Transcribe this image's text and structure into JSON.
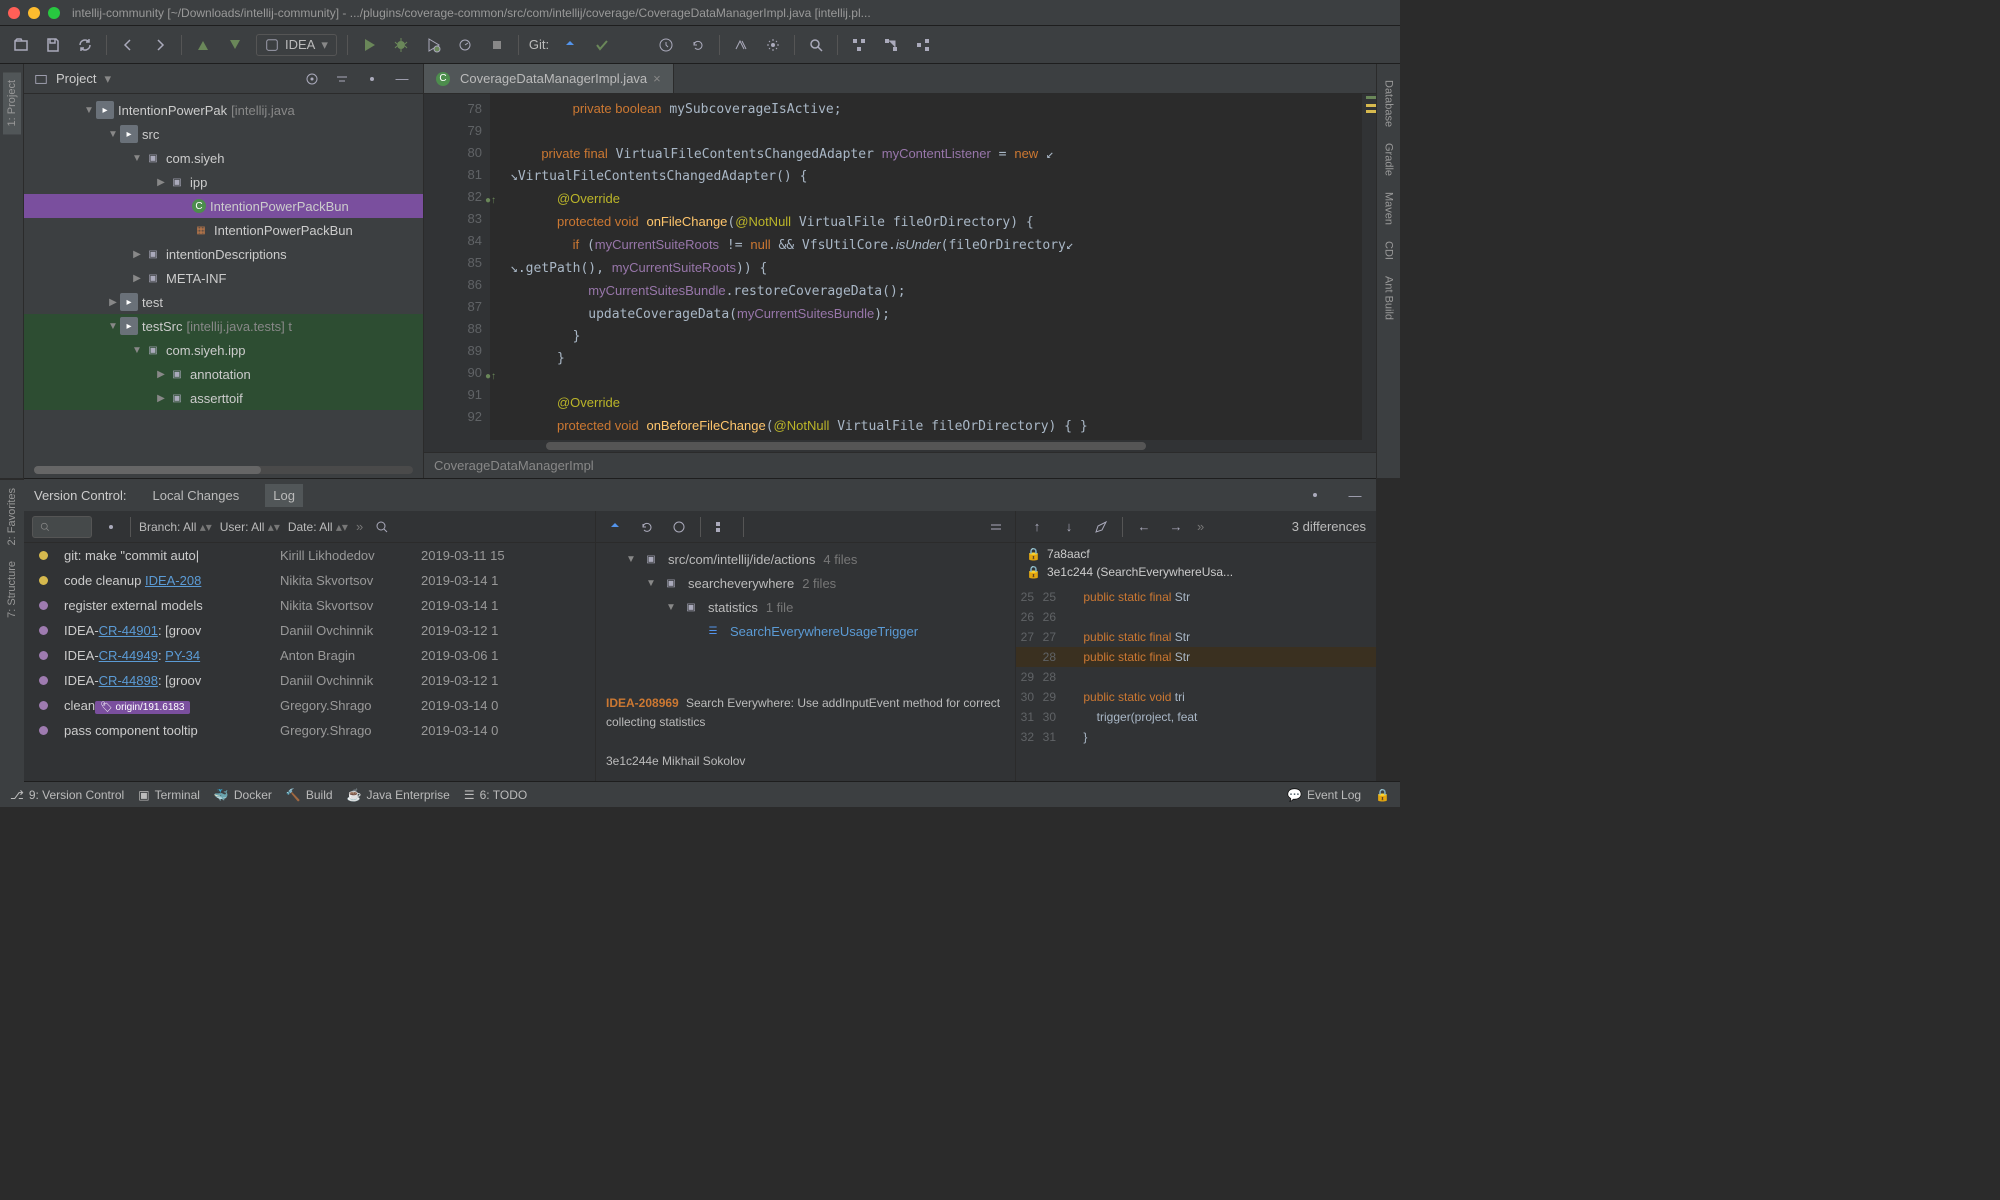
{
  "window": {
    "title": "intellij-community [~/Downloads/intellij-community] - .../plugins/coverage-common/src/com/intellij/coverage/CoverageDataManagerImpl.java [intellij.pl..."
  },
  "toolbar": {
    "run_config": "IDEA",
    "git_label": "Git:"
  },
  "left_tabs": {
    "project": "1: Project",
    "favorites": "2: Favorites",
    "structure": "7: Structure"
  },
  "right_tabs": {
    "database": "Database",
    "gradle": "Gradle",
    "maven": "Maven",
    "cdi": "CDI",
    "ant": "Ant Build"
  },
  "project": {
    "header": "Project",
    "tree": [
      {
        "indent": 58,
        "arrow": "▼",
        "icon": "folder",
        "label": "IntentionPowerPak",
        "extra": "[intellij.java"
      },
      {
        "indent": 82,
        "arrow": "▼",
        "icon": "folder",
        "label": "src",
        "cls": "blue"
      },
      {
        "indent": 106,
        "arrow": "▼",
        "icon": "pkg",
        "label": "com.siyeh"
      },
      {
        "indent": 130,
        "arrow": "▶",
        "icon": "pkg",
        "label": "ipp"
      },
      {
        "indent": 154,
        "arrow": "",
        "icon": "class",
        "label": "IntentionPowerPackBun",
        "selected": true
      },
      {
        "indent": 154,
        "arrow": "",
        "icon": "bundle",
        "label": "IntentionPowerPackBun"
      },
      {
        "indent": 106,
        "arrow": "▶",
        "icon": "pkg",
        "label": "intentionDescriptions"
      },
      {
        "indent": 106,
        "arrow": "▶",
        "icon": "pkg",
        "label": "META-INF"
      },
      {
        "indent": 82,
        "arrow": "▶",
        "icon": "folder",
        "label": "test"
      },
      {
        "indent": 82,
        "arrow": "▼",
        "icon": "folder",
        "label": "testSrc",
        "extra": "[intellij.java.tests]  t",
        "testsrc": true
      },
      {
        "indent": 106,
        "arrow": "▼",
        "icon": "pkg",
        "label": "com.siyeh.ipp",
        "testsrc": true
      },
      {
        "indent": 130,
        "arrow": "▶",
        "icon": "pkg",
        "label": "annotation",
        "testsrc": true
      },
      {
        "indent": 130,
        "arrow": "▶",
        "icon": "pkg",
        "label": "asserttoif",
        "testsrc": true
      }
    ]
  },
  "editor": {
    "tab_name": "CoverageDataManagerImpl.java",
    "breadcrumb": "CoverageDataManagerImpl",
    "lines": [
      78,
      79,
      80,
      81,
      82,
      83,
      84,
      85,
      86,
      87,
      88,
      89,
      90,
      91,
      92
    ]
  },
  "vcs": {
    "header": "Version Control:",
    "tab_local": "Local Changes",
    "tab_log": "Log",
    "filters": {
      "branch": "Branch: All",
      "user": "User: All",
      "date": "Date: All"
    },
    "commits": [
      {
        "msg": "git: make \"commit auto|",
        "auth": "Kirill Likhodedov",
        "date": "2019-03-11 15",
        "g": "y"
      },
      {
        "msg": "code cleanup <a>IDEA-208</a>",
        "auth": "Nikita Skvortsov",
        "date": "2019-03-14 1",
        "g": "y"
      },
      {
        "msg": "register external models",
        "auth": "Nikita Skvortsov",
        "date": "2019-03-14 1",
        "g": "p"
      },
      {
        "msg": "IDEA-<a>CR-44901</a>: [groov",
        "auth": "Daniil Ovchinnik",
        "date": "2019-03-12 1",
        "g": "p"
      },
      {
        "msg": "IDEA-<a>CR-44949</a>: <a>PY-34</a>",
        "auth": "Anton Bragin",
        "date": "2019-03-06 1",
        "g": "p"
      },
      {
        "msg": "IDEA-<a>CR-44898</a>: [groov",
        "auth": "Daniil Ovchinnik",
        "date": "2019-03-12 1",
        "g": "p"
      },
      {
        "msg": "clean<tag>origin/191.6183</tag>",
        "auth": "Gregory.Shrago",
        "date": "2019-03-14 0",
        "g": "p"
      },
      {
        "msg": "pass component tooltip",
        "auth": "Gregory.Shrago",
        "date": "2019-03-14 0",
        "g": "p"
      }
    ],
    "files": {
      "path": "src/com/intellij/ide/actions",
      "path_count": "4 files",
      "sub1": "searcheverywhere",
      "sub1_count": "2 files",
      "sub2": "statistics",
      "sub2_count": "1 file",
      "file": "SearchEverywhereUsageTrigger"
    },
    "commit_issue": "IDEA-208969",
    "commit_msg": "Search Everywhere: Use addInputEvent method for correct collecting statistics",
    "commit_hash": "3e1c244e Mikhail Sokolov",
    "diff": {
      "diff_label": "3 differences",
      "hash1": "7a8aacf",
      "hash2": "3e1c244 (SearchEverywhereUsa...",
      "lines": [
        {
          "l": "25",
          "r": "25",
          "code": "    public static final Str"
        },
        {
          "l": "26",
          "r": "26",
          "code": ""
        },
        {
          "l": "27",
          "r": "27",
          "code": "    public static final Str"
        },
        {
          "l": "",
          "r": "28",
          "code": "    public static final Str",
          "ch": true
        },
        {
          "l": "29",
          "r": "28",
          "code": ""
        },
        {
          "l": "30",
          "r": "29",
          "code": "    public static void tri"
        },
        {
          "l": "31",
          "r": "30",
          "code": "        trigger(project, feat"
        },
        {
          "l": "32",
          "r": "31",
          "code": "    }"
        }
      ]
    }
  },
  "bottom": {
    "vcs": "9: Version Control",
    "term": "Terminal",
    "docker": "Docker",
    "build": "Build",
    "jee": "Java Enterprise",
    "todo": "6: TODO",
    "eventlog": "Event Log"
  }
}
